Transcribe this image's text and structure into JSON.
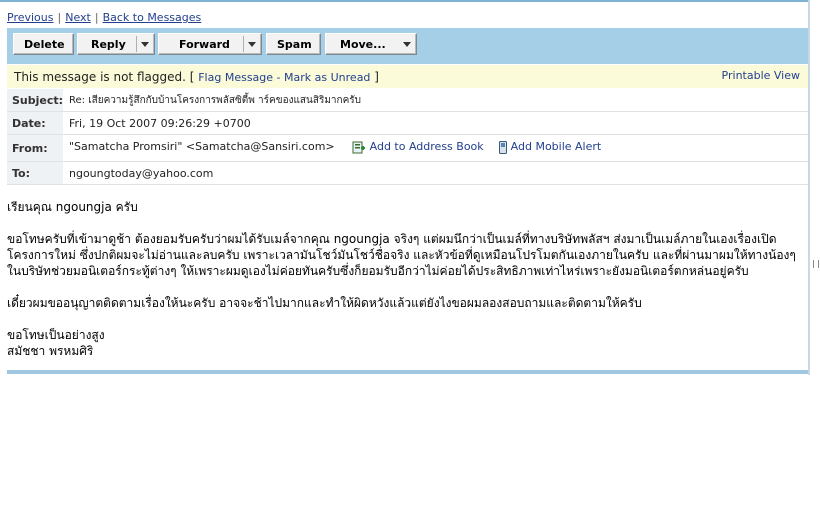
{
  "nav": {
    "previous": "Previous",
    "next": "Next",
    "back": "Back to Messages",
    "sep": "|"
  },
  "toolbar": {
    "delete": "Delete",
    "reply": "Reply",
    "forward": "Forward",
    "spam": "Spam",
    "move": "Move..."
  },
  "flag": {
    "status": "This message is not flagged. [",
    "flag_link": "Flag Message",
    "dash": " - ",
    "unread_link": "Mark as Unread",
    "close": " ]",
    "printable": "Printable View"
  },
  "headers": {
    "subject_label": "Subject:",
    "subject": "Re: เสียความรู้สึกกับบ้านโครงการพลัสซิตี้พ าร์คของแสนสิริมากครับ",
    "date_label": "Date:",
    "date": "Fri, 19 Oct 2007 09:26:29 +0700",
    "from_label": "From:",
    "from": "\"Samatcha Promsiri\" <Samatcha@Sansiri.com>",
    "add_address": "Add to Address Book",
    "add_mobile": "Add Mobile Alert",
    "to_label": "To:",
    "to": "ngoungtoday@yahoo.com"
  },
  "body": {
    "greeting": "เรียนคุณ ngoungja ครับ",
    "para1_line1": "ขอโทษครับที่เข้ามาดูช้า ต้องยอมรับครับว่าผมได้รับเมล์จากคุณ ngoungja จริงๆ แต่ผมนึกว่าเป็นเมล์ที่ทางบริษัทพลัสฯ ส่งมาเป็นเมล์ภายในเองเรื่องเปิด",
    "para1_line2": "โครงการใหม่ ซึ่งปกติผมจะไม่อ่านและลบครับ เพราะเวลามันโชว์มันโชว์ชื่อจริง และหัวข้อที่ดูเหมือนโปรโมตกันเองภายในครับ และที่ผ่านมาผมให้ทางน้องๆ",
    "para1_line3": "ในบริษัทช่วยมอนิเตอร์กระทู้ต่างๆ ให้เพราะผมดูเองไม่ค่อยทันครับซึ่งก็ยอมรับอีกว่าไม่ค่อยได้ประสิทธิภาพเท่าไหร่เพราะยังมอนิเตอร์ตกหล่นอยู่ครับ",
    "para2": "เดี๋ยวผมขออนุญาตติดตามเรื่องให้นะครับ อาจจะช้าไปมากและทำให้ผิดหวังแล้วแต่ยังไงขอผมลองสอบถามและติดตามให้ครับ",
    "closing1": "ขอโทษเป็นอย่างสูง",
    "closing2": "สมัชชา พรหมศิริ"
  }
}
